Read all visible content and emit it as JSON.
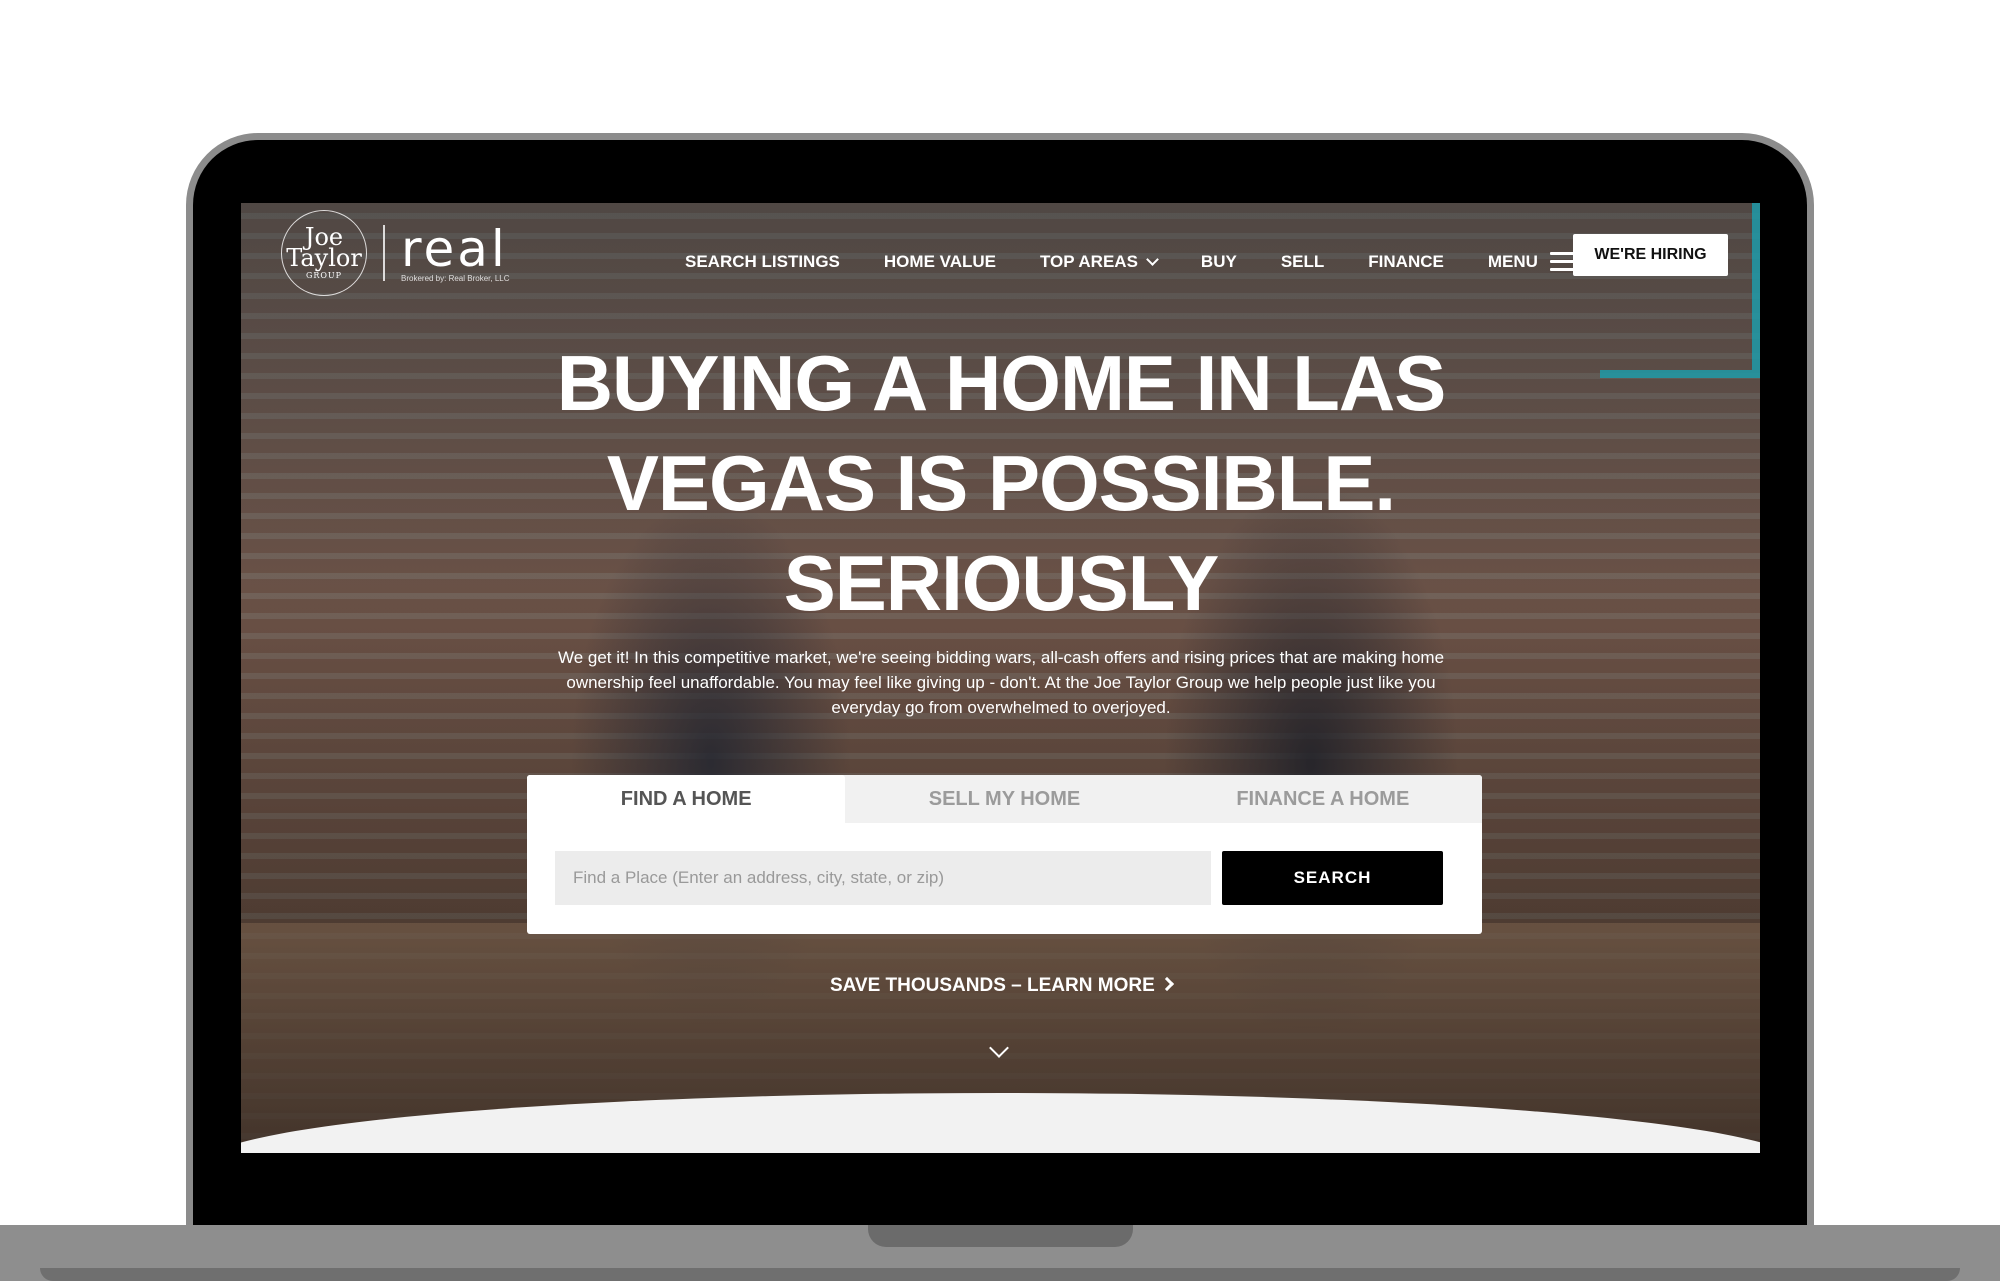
{
  "brand": {
    "logo_line1": "Joe",
    "logo_line2": "Taylor",
    "logo_line3": "GROUP",
    "partner_logo": "real",
    "partner_sub": "Brokered by: Real Broker, LLC"
  },
  "nav": {
    "items": [
      {
        "label": "SEARCH LISTINGS"
      },
      {
        "label": "HOME VALUE"
      },
      {
        "label": "TOP AREAS"
      },
      {
        "label": "BUY"
      },
      {
        "label": "SELL"
      },
      {
        "label": "FINANCE"
      },
      {
        "label": "MENU"
      }
    ],
    "hiring_button": "WE'RE HIRING"
  },
  "hero": {
    "headline": "BUYING A HOME IN LAS VEGAS IS POSSIBLE. SERIOUSLY",
    "intro": "We get it! In this competitive market, we're seeing bidding wars, all-cash offers and rising prices that are making home ownership feel unaffordable. You may feel like giving up - don't. At the Joe Taylor Group we help people just like you everyday go from overwhelmed to overjoyed."
  },
  "search": {
    "tabs": [
      {
        "label": "FIND A HOME",
        "active": true
      },
      {
        "label": "SELL MY HOME",
        "active": false
      },
      {
        "label": "FINANCE A HOME",
        "active": false
      }
    ],
    "placeholder": "Find a Place (Enter an address, city, state, or zip)",
    "button": "SEARCH"
  },
  "cta": {
    "save_link": "SAVE THOUSANDS – LEARN MORE"
  },
  "colors": {
    "accent": "#1f9aa8",
    "button_dark": "#000000"
  }
}
